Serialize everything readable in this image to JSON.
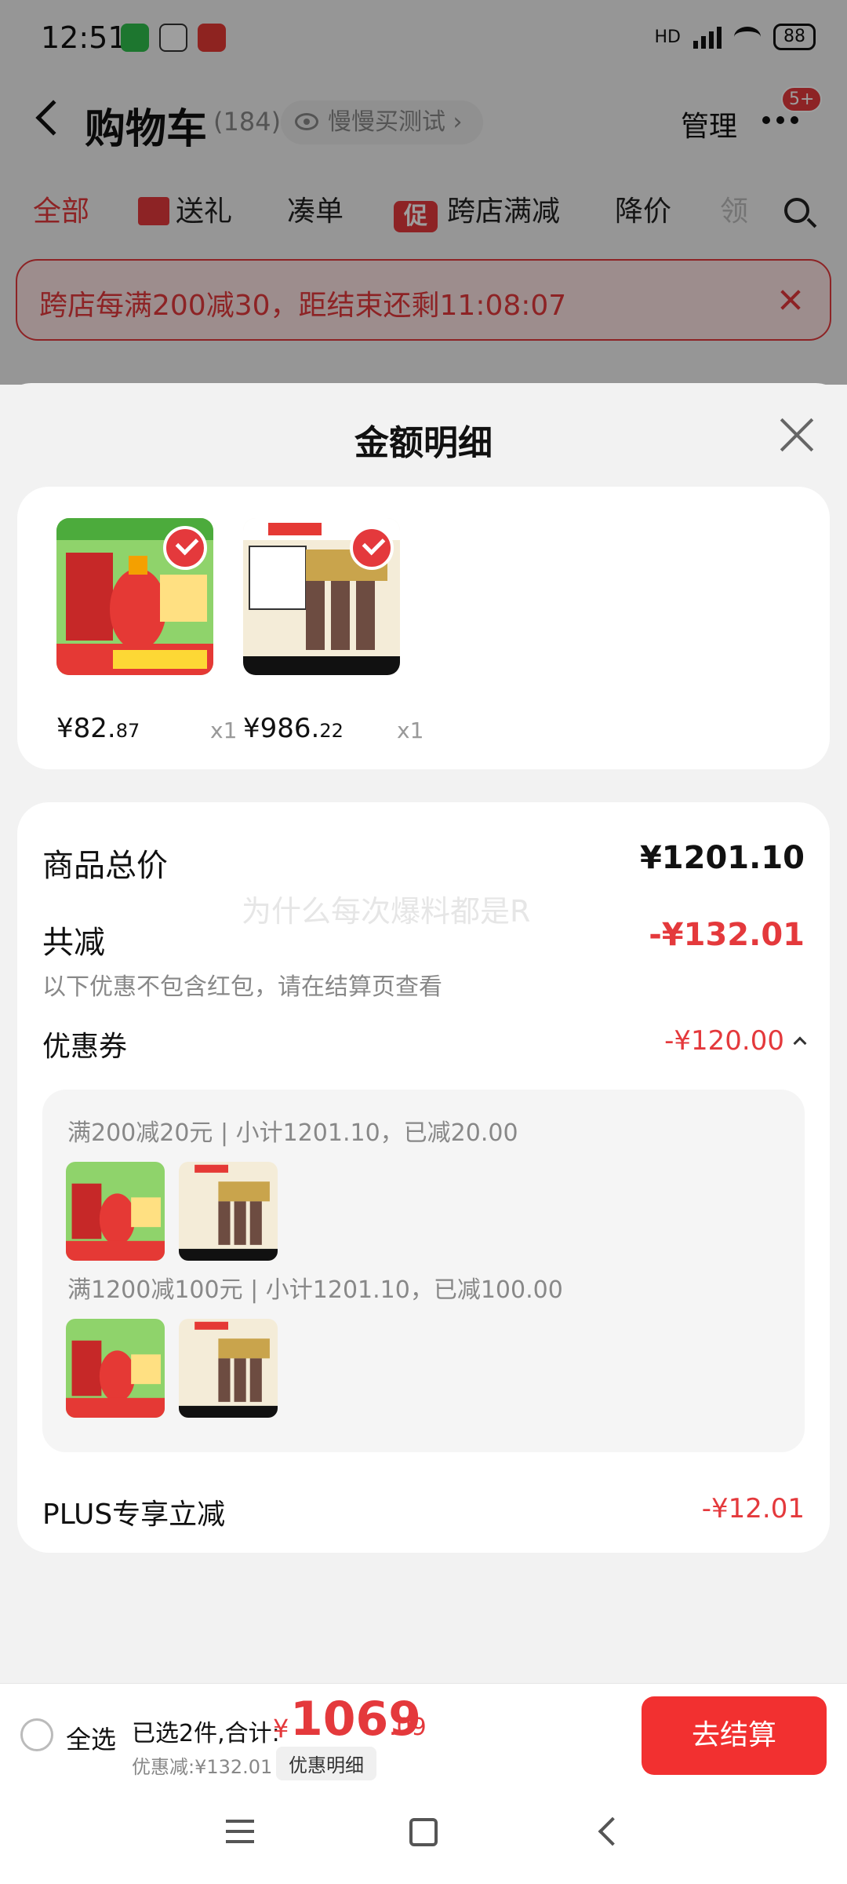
{
  "status_bar": {
    "time": "12:51",
    "network": "HD",
    "battery": "88",
    "apps": [
      "wechat-icon",
      "qq-icon",
      "app-icon"
    ]
  },
  "cart_header": {
    "title": "购物车",
    "count": "(184)",
    "slow_buy_label": "慢慢买测试",
    "manage_label": "管理",
    "more_badge": "5+"
  },
  "cart_tabs": [
    {
      "label": "全部",
      "active": true
    },
    {
      "label": "送礼",
      "icon": "gift-icon"
    },
    {
      "label": "凑单"
    },
    {
      "label": "跨店满减",
      "icon": "promo-icon",
      "icon_text": "促"
    },
    {
      "label": "降价"
    },
    {
      "label": "领"
    }
  ],
  "promo_banner": {
    "text": "跨店每满200减30，距结束还剩11:08:07"
  },
  "sheet": {
    "title": "金额明细",
    "products": [
      {
        "price_main": "¥82.",
        "price_cents": "87",
        "qty": "x1"
      },
      {
        "price_main": "¥986.",
        "price_cents": "22",
        "qty": "x1"
      }
    ],
    "summary": {
      "total_label": "商品总价",
      "total_value": "¥1201.10",
      "reduce_label": "共减",
      "reduce_value": "-¥132.01",
      "reduce_note": "以下优惠不包含红包，请在结算页查看",
      "watermark": "为什么每次爆料都是R",
      "coupon_label": "优惠券",
      "coupon_value": "-¥120.00",
      "coupon_rules": [
        "满200减20元 | 小计1201.10，已减20.00",
        "满1200减100元 | 小计1201.10，已减100.00"
      ],
      "plus_label": "PLUS专享立减",
      "plus_value": "-¥12.01"
    }
  },
  "checkout_bar": {
    "select_all_label": "全选",
    "selected_summary": "已选2件,合计:",
    "total_yen": "¥",
    "total_int": "1069",
    "total_cents": ".09",
    "discount_summary": "优惠减:¥132.01",
    "discount_detail_label": "优惠明细",
    "checkout_label": "去结算"
  },
  "colors": {
    "accent": "#e4393c",
    "checkout_button": "#f23030"
  }
}
